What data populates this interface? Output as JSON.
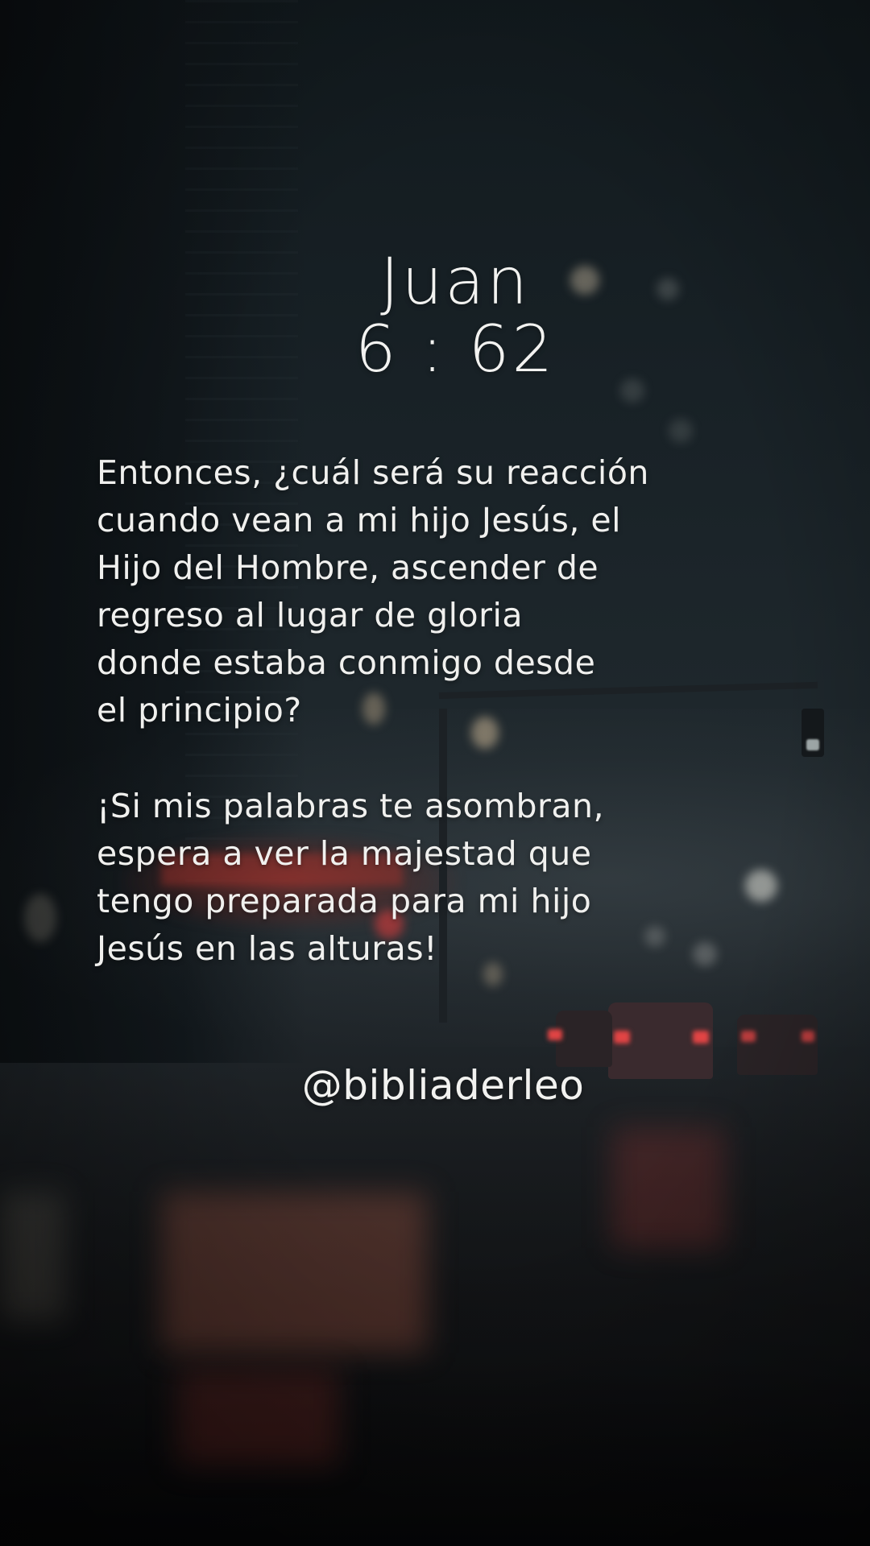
{
  "verse": {
    "book": "Juan",
    "reference": "6 : 62",
    "paragraph_1": [
      "Entonces, ¿cuál será su reacción",
      "cuando vean a mi hijo Jesús, el",
      "Hijo del Hombre, ascender de",
      "regreso al lugar de gloria",
      "donde estaba conmigo desde",
      "el principio?"
    ],
    "paragraph_2": [
      "¡Si mis palabras te asombran,",
      "espera a ver la majestad que",
      "tengo preparada para mi hijo",
      "Jesús en las alturas!"
    ]
  },
  "handle": "@bibliaderleo",
  "colors": {
    "text": "#f2f2f0",
    "background_dark": "#0f1417",
    "taillight": "#eb4646"
  }
}
